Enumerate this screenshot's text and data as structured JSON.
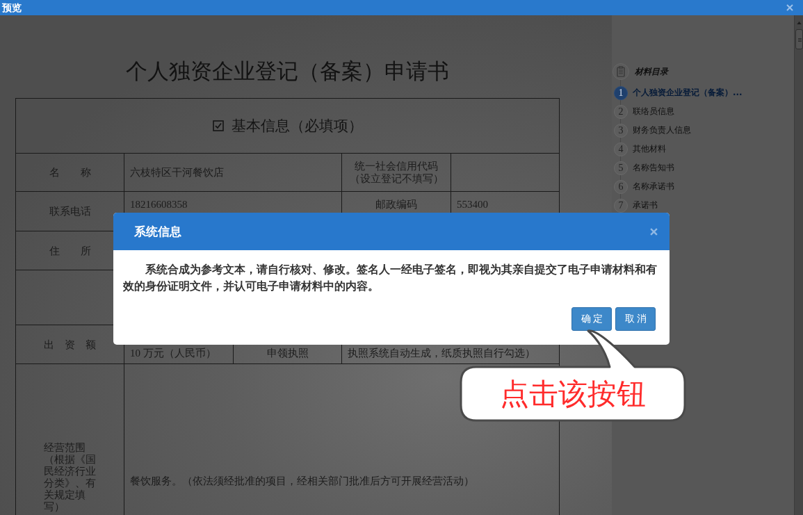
{
  "window": {
    "title": "预览"
  },
  "document": {
    "title": "个人独资企业登记（备案）申请书",
    "section": {
      "title": "基本信息（必填项）",
      "checked": true
    },
    "rows": [
      {
        "kind": "split",
        "cells": [
          "名　　称",
          "六枝特区干河餐饮店",
          "统一社会信用代码（设立登记不填写）"
        ]
      },
      {
        "kind": "split",
        "cells": [
          "联系电话",
          "18216608358",
          "邮政编码",
          "553400"
        ]
      },
      {
        "kind": "full",
        "cells": [
          "住　　所"
        ]
      },
      {
        "kind": "blank"
      },
      {
        "kind": "fee",
        "cells": [
          "出　资　额",
          "10 万元（人民币）",
          "申领执照",
          "执照系统自动生成，纸质执照自行勾选）"
        ]
      },
      {
        "kind": "tall",
        "cells": [
          "经营范围（根据《国民经济行业分类》、有关规定填写）",
          "餐饮服务。（依法须经批准的项目，经相关部门批准后方可开展经营活动）"
        ]
      }
    ]
  },
  "catalog": {
    "title": "材料目录",
    "items": [
      {
        "number": "1",
        "label": "个人独资企业登记（备案）...",
        "selected": true
      },
      {
        "number": "2",
        "label": "联络员信息",
        "selected": false
      },
      {
        "number": "3",
        "label": "财务负责人信息",
        "selected": false
      },
      {
        "number": "4",
        "label": "其他材料",
        "selected": false
      },
      {
        "number": "5",
        "label": "名称告知书",
        "selected": false
      },
      {
        "number": "6",
        "label": "名称承诺书",
        "selected": false
      },
      {
        "number": "7",
        "label": "承诺书",
        "selected": false
      }
    ]
  },
  "dialog": {
    "title": "系统信息",
    "message": "系统合成为参考文本，请自行核对、修改。签名人一经电子签名，即视为其亲自提交了电子申请材料和有效的身份证明文件，并认可电子申请材料中的内容。",
    "buttons": [
      "确定",
      "取消"
    ]
  },
  "callout": {
    "text": "点击该按钮"
  }
}
